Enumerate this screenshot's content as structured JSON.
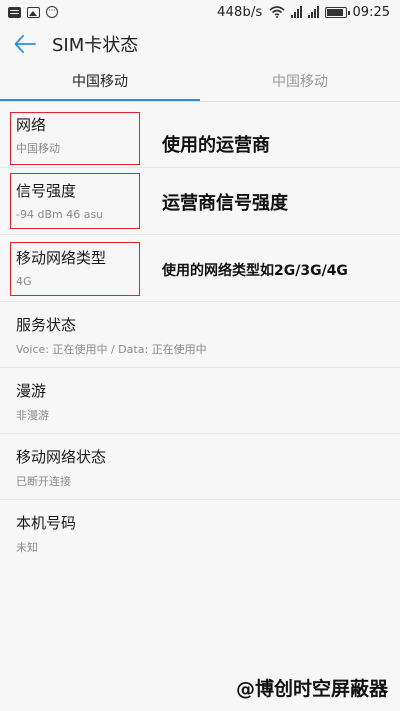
{
  "status_bar": {
    "net_speed": "448b/s",
    "time": "09:25",
    "battery_level": 0.9,
    "icons": [
      "message-icon",
      "image-icon",
      "circle-icon",
      "wifi-icon",
      "signal-icon",
      "battery-icon"
    ]
  },
  "header": {
    "title": "SIM卡状态",
    "back_icon": "arrow-left-icon",
    "accent": "#2a8fd6"
  },
  "tabs": [
    {
      "label": "中国移动",
      "active": true
    },
    {
      "label": "中国移动",
      "active": false
    }
  ],
  "items": [
    {
      "title": "网络",
      "value": "中国移动"
    },
    {
      "title": "信号强度",
      "value": "-94 dBm 46 asu"
    },
    {
      "title": "移动网络类型",
      "value": "4G"
    },
    {
      "title": "服务状态",
      "value": "Voice: 正在使用中 / Data: 正在使用中"
    },
    {
      "title": "漫游",
      "value": "非漫游"
    },
    {
      "title": "移动网络状态",
      "value": "已断开连接"
    },
    {
      "title": "本机号码",
      "value": "未知"
    }
  ],
  "annotations": [
    {
      "text": "使用的运营商"
    },
    {
      "text": "运营商信号强度"
    },
    {
      "text": "使用的网络类型如2G/3G/4G"
    }
  ],
  "annotation_color": "#e0232f",
  "watermark": "@博创时空屏蔽器"
}
